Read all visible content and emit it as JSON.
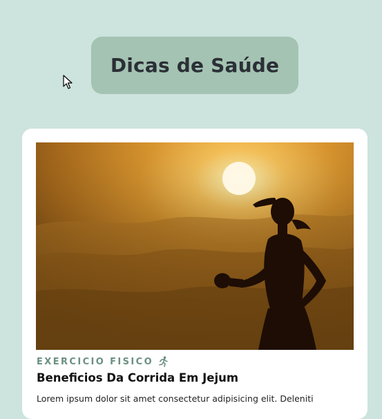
{
  "header": {
    "title": "Dicas de Saúde"
  },
  "card": {
    "image_alt": "Silhueta de mulher correndo ao pôr do sol",
    "category": "EXERCICIO FISICO",
    "category_icon": "running-icon",
    "title": "Beneficios Da Corrida Em Jejum",
    "body": "Lorem ipsum dolor sit amet consectetur adipisicing elit. Deleniti"
  },
  "colors": {
    "background": "#cce3de",
    "header_bg": "#a4c3b2",
    "accent": "#6b9080",
    "card_bg": "#ffffff"
  }
}
